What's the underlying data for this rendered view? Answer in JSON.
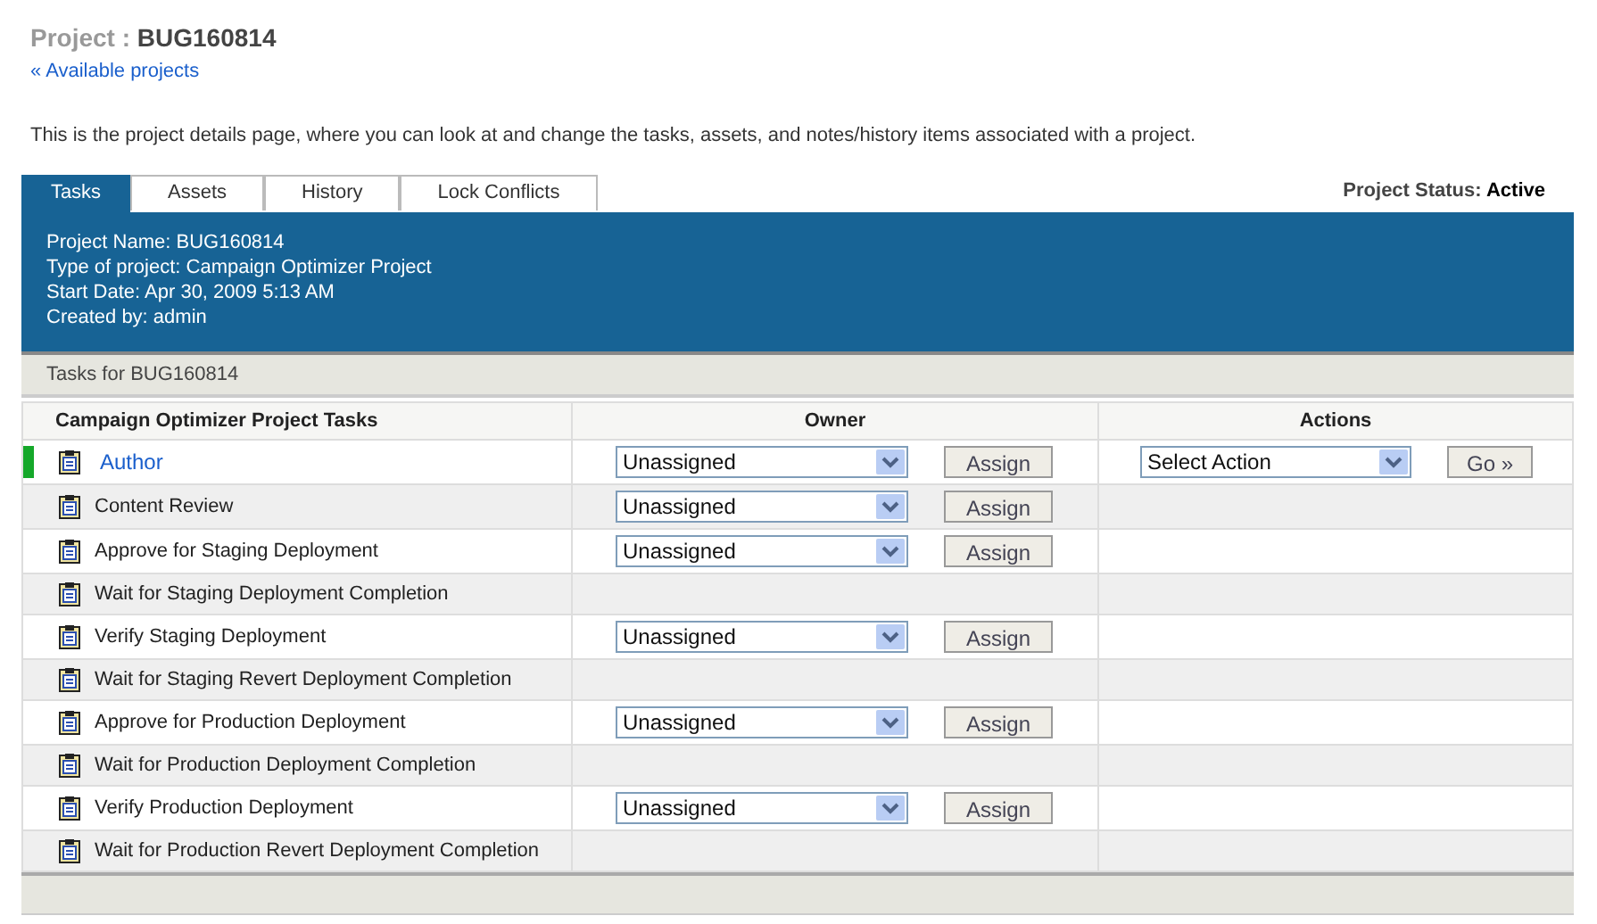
{
  "title": {
    "label": "Project :",
    "value": "BUG160814"
  },
  "back_link": "« Available projects",
  "description": "This is the project details page, where you can look at and change the tasks, assets, and notes/history items associated with a project.",
  "tabs": [
    {
      "label": "Tasks",
      "selected": true
    },
    {
      "label": "Assets",
      "selected": false
    },
    {
      "label": "History",
      "selected": false
    },
    {
      "label": "Lock Conflicts",
      "selected": false
    }
  ],
  "project_status": {
    "label": "Project Status:",
    "value": "Active"
  },
  "details": [
    "Project Name: BUG160814",
    "Type of project: Campaign Optimizer Project",
    "Start Date: Apr 30, 2009 5:13 AM",
    "Created by: admin"
  ],
  "section_title": "Tasks for BUG160814",
  "columns": [
    "Campaign Optimizer Project Tasks",
    "Owner",
    "Actions"
  ],
  "tasks": [
    {
      "name": "Author",
      "current": true,
      "owner": {
        "value": "Unassigned",
        "button": "Assign"
      },
      "action": {
        "value": "Select Action",
        "button": "Go »"
      }
    },
    {
      "name": "Content Review",
      "current": false,
      "owner": {
        "value": "Unassigned",
        "button": "Assign"
      }
    },
    {
      "name": "Approve for Staging Deployment",
      "current": false,
      "owner": {
        "value": "Unassigned",
        "button": "Assign"
      }
    },
    {
      "name": "Wait for Staging Deployment Completion",
      "current": false
    },
    {
      "name": "Verify Staging Deployment",
      "current": false,
      "owner": {
        "value": "Unassigned",
        "button": "Assign"
      }
    },
    {
      "name": "Wait for Staging Revert Deployment Completion",
      "current": false
    },
    {
      "name": "Approve for Production Deployment",
      "current": false,
      "owner": {
        "value": "Unassigned",
        "button": "Assign"
      }
    },
    {
      "name": "Wait for Production Deployment Completion",
      "current": false
    },
    {
      "name": "Verify Production Deployment",
      "current": false,
      "owner": {
        "value": "Unassigned",
        "button": "Assign"
      }
    },
    {
      "name": "Wait for Production Revert Deployment Completion",
      "current": false
    }
  ]
}
